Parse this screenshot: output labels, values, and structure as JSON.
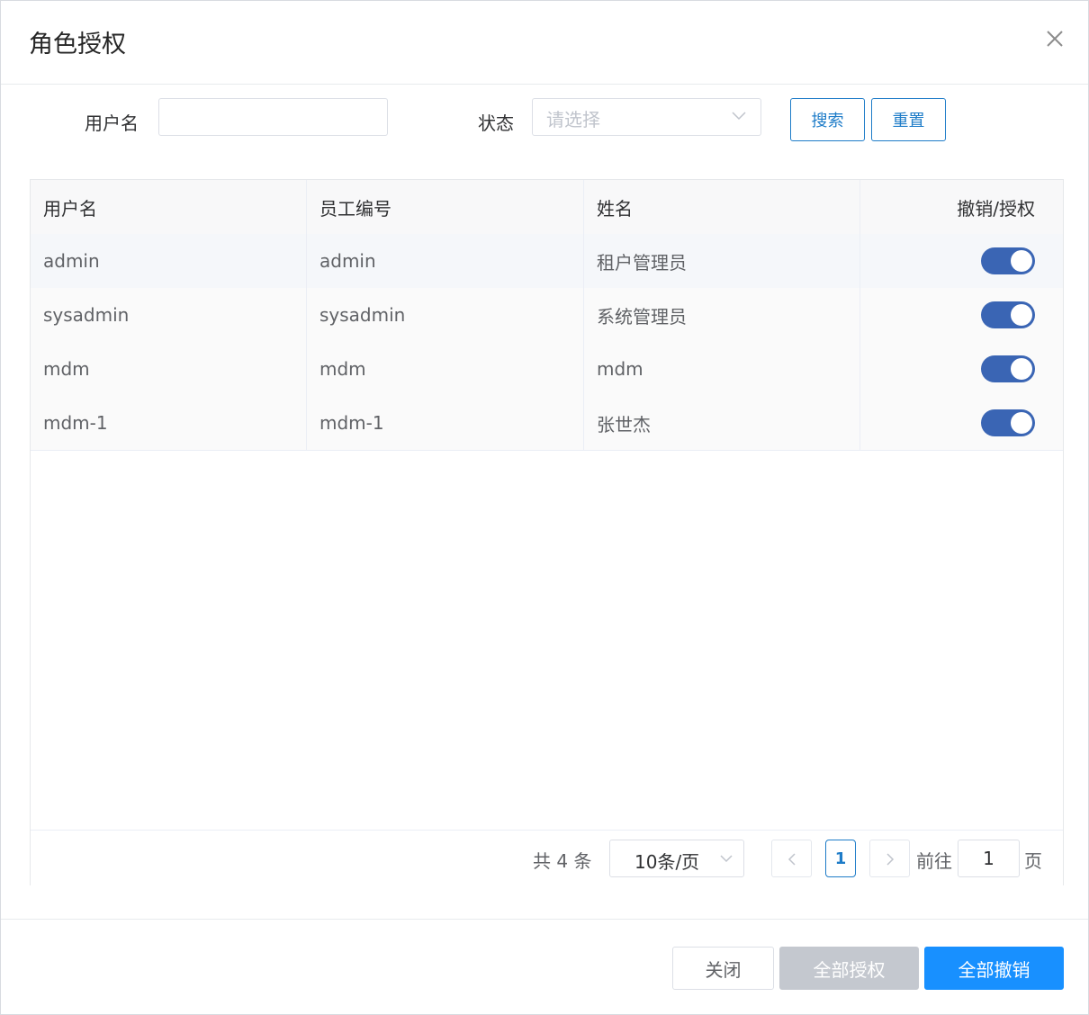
{
  "dialog": {
    "title": "角色授权"
  },
  "search": {
    "username_label": "用户名",
    "username_value": "",
    "status_label": "状态",
    "status_placeholder": "请选择",
    "search_button": "搜索",
    "reset_button": "重置"
  },
  "table": {
    "headers": [
      "用户名",
      "员工编号",
      "姓名",
      "撤销/授权"
    ],
    "rows": [
      {
        "username": "admin",
        "employee_no": "admin",
        "name": "租户管理员",
        "authorized": true
      },
      {
        "username": "sysadmin",
        "employee_no": "sysadmin",
        "name": "系统管理员",
        "authorized": true
      },
      {
        "username": "mdm",
        "employee_no": "mdm",
        "name": "mdm",
        "authorized": true
      },
      {
        "username": "mdm-1",
        "employee_no": "mdm-1",
        "name": "张世杰",
        "authorized": true
      }
    ]
  },
  "pagination": {
    "total_text": "共 4 条",
    "page_size": "10条/页",
    "current_page": "1",
    "goto_prefix": "前往",
    "goto_value": "1",
    "goto_suffix": "页"
  },
  "footer": {
    "close_button": "关闭",
    "grant_all_button": "全部授权",
    "revoke_all_button": "全部撤销"
  },
  "colors": {
    "primary": "#1890ff",
    "switch_on": "#3a65b4",
    "outline_blue": "#1e7cc8",
    "disabled": "#c4c8cf"
  }
}
